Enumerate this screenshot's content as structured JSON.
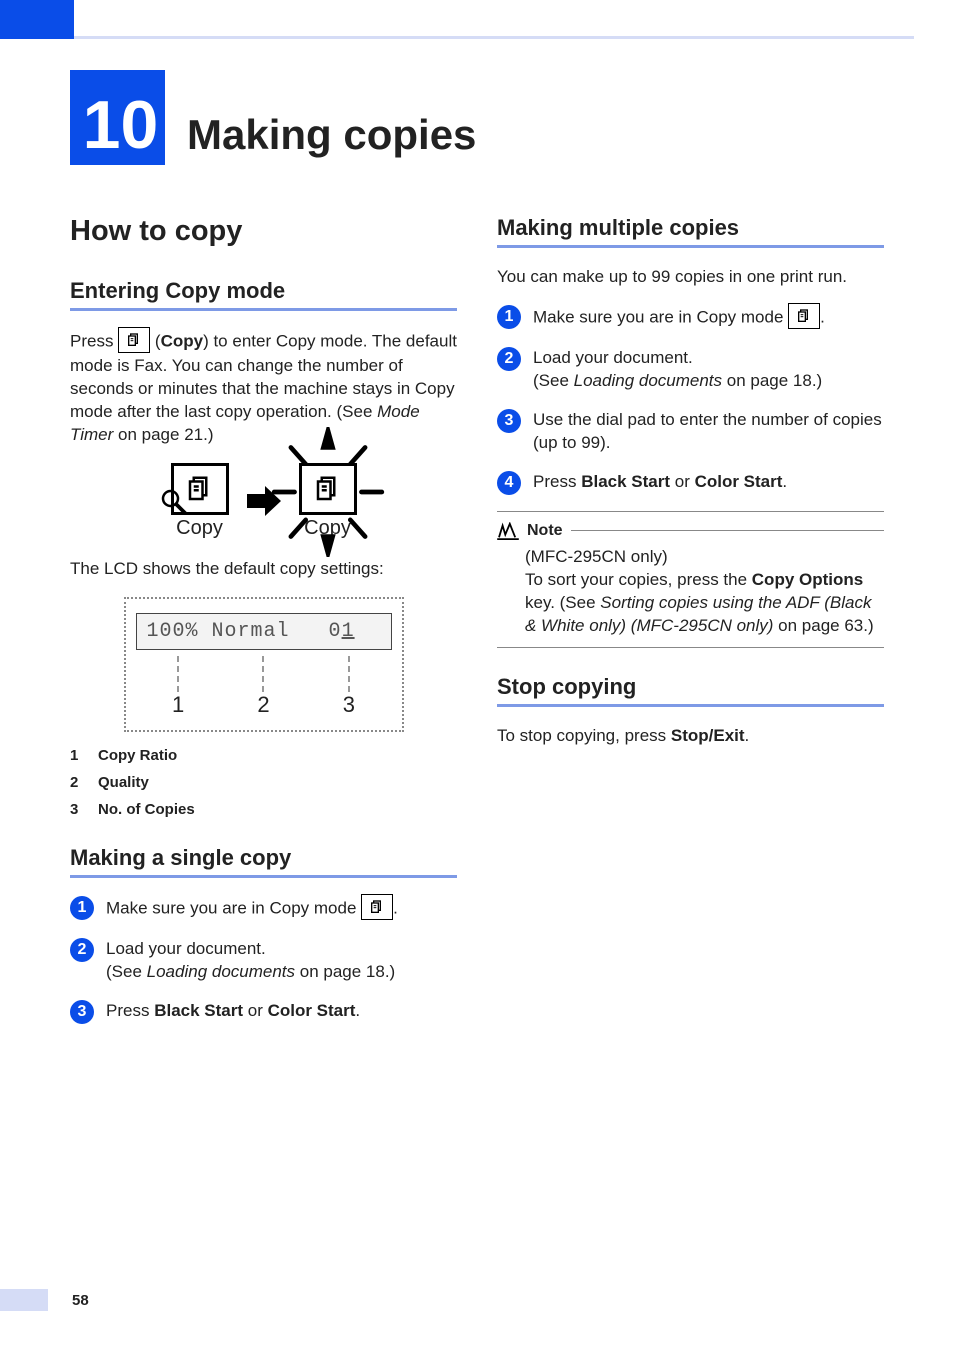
{
  "chapter": {
    "number": "10",
    "title": "Making copies"
  },
  "left": {
    "h2": "How to copy",
    "entering": {
      "heading": "Entering Copy mode",
      "para_before": "Press ",
      "copy_bold": "Copy",
      "para_mid": ") to enter Copy mode. The default mode is Fax. You can change the number of seconds or minutes that the machine stays in Copy mode after the last copy operation. (See ",
      "mode_timer_ref": "Mode Timer",
      "para_after": " on page 21.)",
      "diagram_label": "Copy",
      "lcd_intro": "The LCD shows the default copy settings:",
      "lcd_line": {
        "left": "100% Normal",
        "right_prefix": "0",
        "right_underline": "1"
      },
      "callouts": [
        "1",
        "2",
        "3"
      ],
      "legend": [
        {
          "n": "1",
          "t": "Copy Ratio"
        },
        {
          "n": "2",
          "t": "Quality"
        },
        {
          "n": "3",
          "t": "No. of Copies"
        }
      ]
    },
    "single": {
      "heading": "Making a single copy",
      "steps": [
        {
          "n": "1",
          "prefix": "Make sure you are in Copy mode ",
          "has_icon": true,
          "suffix": "."
        },
        {
          "n": "2",
          "t1": "Load your document.",
          "t2a": "(See ",
          "t2b": "Loading documents",
          "t2c": " on page 18.)"
        },
        {
          "n": "3",
          "p1": "Press ",
          "b1": "Black Start",
          "p2": " or ",
          "b2": "Color Start",
          "p3": "."
        }
      ]
    }
  },
  "right": {
    "multiple": {
      "heading": "Making multiple copies",
      "intro": "You can make up to 99 copies in one print run.",
      "steps": [
        {
          "n": "1",
          "prefix": "Make sure you are in Copy mode ",
          "has_icon": true,
          "suffix": "."
        },
        {
          "n": "2",
          "t1": "Load your document.",
          "t2a": "(See ",
          "t2b": "Loading documents",
          "t2c": " on page 18.)"
        },
        {
          "n": "3",
          "text": "Use the dial pad to enter the number of copies (up to 99)."
        },
        {
          "n": "4",
          "p1": "Press ",
          "b1": "Black Start",
          "p2": " or ",
          "b2": "Color Start",
          "p3": "."
        }
      ],
      "note": {
        "label": "Note",
        "l1": "(MFC-295CN only)",
        "l2": "To sort your copies, press the ",
        "b": "Copy Options",
        "l2b": " key. (See ",
        "ref": "Sorting copies using the ADF (Black & White only) (MFC-295CN only)",
        "l3": " on page 63.)"
      }
    },
    "stop": {
      "heading": "Stop copying",
      "p1": "To stop copying, press ",
      "b": "Stop/Exit",
      "p2": "."
    }
  },
  "page_number": "58"
}
